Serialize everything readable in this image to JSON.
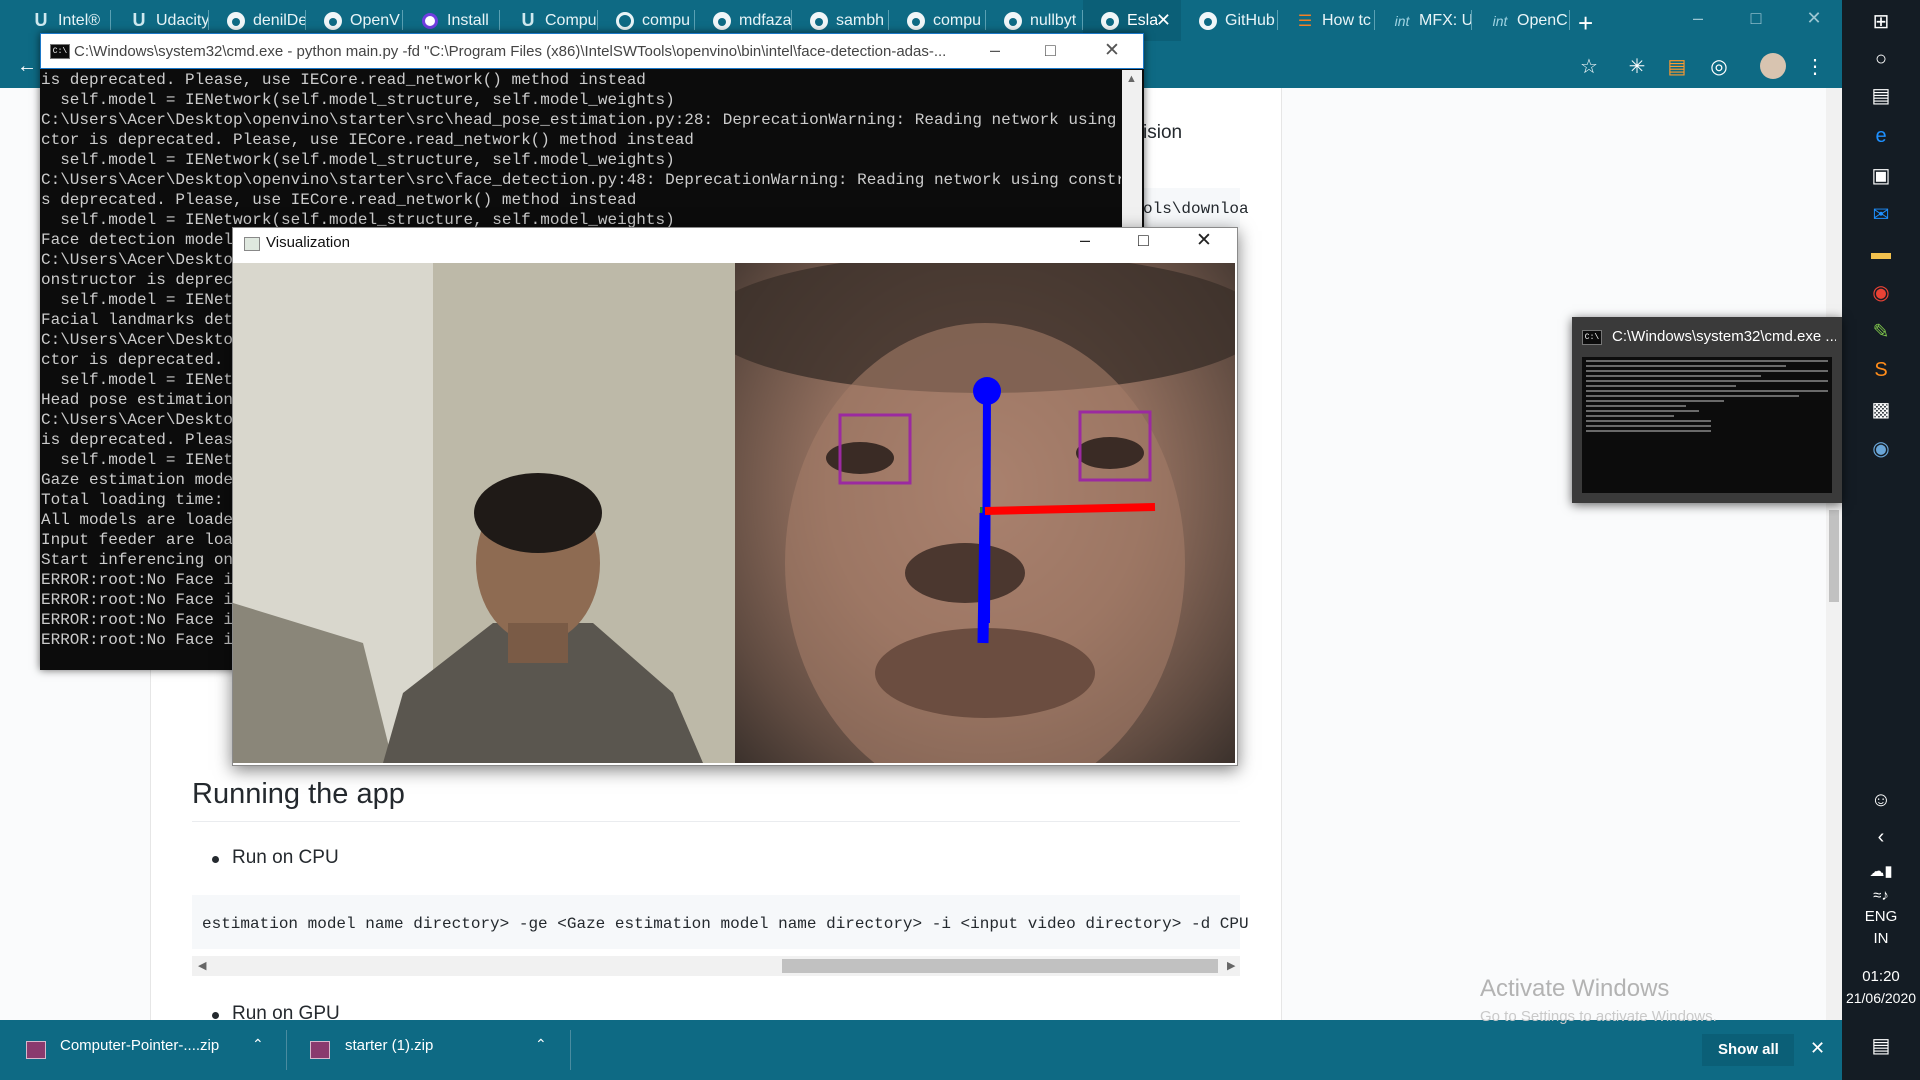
{
  "browser": {
    "tabs": [
      {
        "label": "Intel®",
        "icon": "udacity-icon"
      },
      {
        "label": "Udacity",
        "icon": "udacity-icon"
      },
      {
        "label": "denilDe",
        "icon": "github-icon"
      },
      {
        "label": "OpenV",
        "icon": "github-icon"
      },
      {
        "label": "Install",
        "icon": "circle-icon"
      },
      {
        "label": "Compu",
        "icon": "udacity-icon"
      },
      {
        "label": "compu",
        "icon": "google-icon"
      },
      {
        "label": "mdfaza",
        "icon": "github-icon"
      },
      {
        "label": "sambh",
        "icon": "github-icon"
      },
      {
        "label": "compu",
        "icon": "github-icon"
      },
      {
        "label": "nullbyt",
        "icon": "github-icon"
      },
      {
        "label": "Esla",
        "icon": "github-icon",
        "active": true
      },
      {
        "label": "GitHub",
        "icon": "github-icon"
      },
      {
        "label": "How tc",
        "icon": "stack-icon"
      },
      {
        "label": "MFX: U",
        "icon": "intel-icon"
      },
      {
        "label": "OpenC",
        "icon": "intel-icon"
      }
    ],
    "new_tab": "+"
  },
  "page": {
    "partial_word": "ision",
    "partial_code": "ols\\downloa",
    "heading": "Running the app",
    "bullet1": "Run on CPU",
    "code": "estimation model name directory> -ge <Gaze estimation model name directory> -i <input video directory> -d CPU",
    "bullet2": "Run on GPU"
  },
  "cmd": {
    "title": "C:\\Windows\\system32\\cmd.exe - python  main.py -fd \"C:\\Program Files (x86)\\IntelSWTools\\openvino\\bin\\intel\\face-detection-adas-...",
    "lines_full": [
      "is deprecated. Please, use IECore.read_network() method instead",
      "  self.model = IENetwork(self.model_structure, self.model_weights)",
      "C:\\Users\\Acer\\Desktop\\openvino\\starter\\src\\head_pose_estimation.py:28: DeprecationWarning: Reading network using constru",
      "ctor is deprecated. Please, use IECore.read_network() method instead",
      "  self.model = IENetwork(self.model_structure, self.model_weights)",
      "C:\\Users\\Acer\\Desktop\\openvino\\starter\\src\\face_detection.py:48: DeprecationWarning: Reading network using constructor i",
      "s deprecated. Please, use IECore.read_network() method instead",
      "  self.model = IENetwork(self.model_structure, self.model_weights)"
    ],
    "lines_clipped": [
      "Face detection model",
      "C:\\Users\\Acer\\Desktop",
      "onstructor is depreca",
      "  self.model = IENetw",
      "Facial landmarks dete",
      "C:\\Users\\Acer\\Desktop",
      "ctor is deprecated. P",
      "  self.model = IENetw",
      "Head pose estimation",
      "C:\\Users\\Acer\\Desktop",
      "is deprecated. Please",
      "  self.model = IENetw",
      "Gaze estimation model",
      "Total loading time: t",
      "All models are loaded",
      "Input feeder are load",
      "Start inferencing on",
      "ERROR:root:No Face is",
      "ERROR:root:No Face is",
      "ERROR:root:No Face is",
      "ERROR:root:No Face is"
    ]
  },
  "visualization": {
    "title": "Visualization"
  },
  "downloads": {
    "items": [
      "Computer-Pointer-....zip",
      "starter (1).zip"
    ],
    "show_all": "Show all"
  },
  "taskbar": {
    "preview_title": "C:\\Windows\\system32\\cmd.exe ...",
    "lang1": "ENG",
    "lang2": "IN",
    "time": "01:20",
    "date": "21/06/2020"
  },
  "watermark": {
    "title": "Activate Windows",
    "subtitle": "Go to Settings to activate Windows."
  },
  "colors": {
    "chrome_teal": "#0e6a84",
    "taskbar": "#141c24",
    "cmd_bg": "#0c0c0c"
  }
}
